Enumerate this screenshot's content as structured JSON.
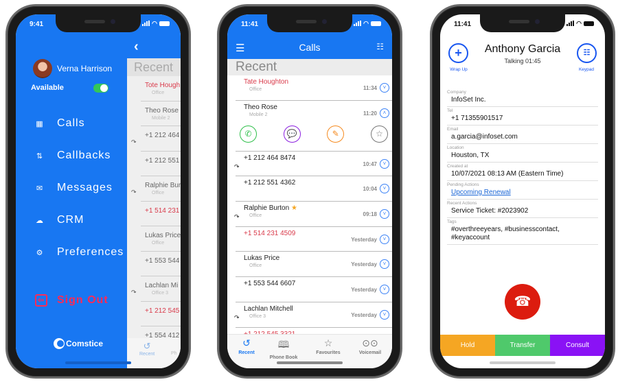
{
  "phone1": {
    "status_time": "9:41",
    "drawer": {
      "user_name": "Verna Harrison",
      "availability_label": "Available",
      "availability_on": true,
      "menu": [
        {
          "label": "Calls",
          "icon": "grid-icon"
        },
        {
          "label": "Callbacks",
          "icon": "arrows-updown-icon"
        },
        {
          "label": "Messages",
          "icon": "envelope-icon"
        },
        {
          "label": "CRM",
          "icon": "cloud-upload-icon"
        },
        {
          "label": "Preferences",
          "icon": "gear-icon"
        }
      ],
      "sign_out_label": "Sign Out",
      "logo_text": "Comstice"
    },
    "behind": {
      "section_title": "Recent",
      "rows": [
        {
          "name": "Tote Hough",
          "sub": "Office",
          "missed": true,
          "forwarded": false
        },
        {
          "name": "Theo Rose",
          "sub": "Mobile 2",
          "missed": false,
          "forwarded": false
        },
        {
          "name": "+1 212 464",
          "sub": "",
          "missed": false,
          "forwarded": true
        },
        {
          "name": "+1 212 551",
          "sub": "",
          "missed": false,
          "forwarded": false
        },
        {
          "name": "Ralphie Bur",
          "sub": "Office",
          "missed": false,
          "forwarded": true
        },
        {
          "name": "+1 514 231",
          "sub": "",
          "missed": true,
          "forwarded": false
        },
        {
          "name": "Lukas Price",
          "sub": "Office",
          "missed": false,
          "forwarded": false
        },
        {
          "name": "+1 553 544",
          "sub": "",
          "missed": false,
          "forwarded": false
        },
        {
          "name": "Lachlan Mi",
          "sub": "Office 3",
          "missed": false,
          "forwarded": true
        },
        {
          "name": "+1 212 545",
          "sub": "",
          "missed": true,
          "forwarded": false
        },
        {
          "name": "+1 554 412",
          "sub": "",
          "missed": false,
          "forwarded": false
        }
      ],
      "tab_recent": "Recent",
      "tab_partial": "Ph"
    }
  },
  "phone2": {
    "status_time": "11:41",
    "nav_title": "Calls",
    "section_title": "Recent",
    "rows": [
      {
        "name": "Tate Houghton",
        "sub": "Office",
        "time": "11:34",
        "missed": true,
        "forwarded": false,
        "favourite": false
      },
      {
        "name": "Theo Rose",
        "sub": "Mobile 2",
        "time": "11:20",
        "missed": false,
        "forwarded": false,
        "favourite": false,
        "expanded": true
      },
      {
        "name": "+1 212 464 8474",
        "sub": "",
        "time": "10:47",
        "missed": false,
        "forwarded": true,
        "favourite": false
      },
      {
        "name": "+1 212 551 4362",
        "sub": "",
        "time": "10:04",
        "missed": false,
        "forwarded": false,
        "favourite": false
      },
      {
        "name": "Ralphie Burton",
        "sub": "Office",
        "time": "09:18",
        "missed": false,
        "forwarded": true,
        "favourite": true
      },
      {
        "name": "+1 514 231 4509",
        "sub": "",
        "time": "Yesterday",
        "missed": true,
        "forwarded": false,
        "favourite": false
      },
      {
        "name": "Lukas Price",
        "sub": "Office",
        "time": "Yesterday",
        "missed": false,
        "forwarded": false,
        "favourite": false
      },
      {
        "name": "+1 553 544 6607",
        "sub": "",
        "time": "Yesterday",
        "missed": false,
        "forwarded": false,
        "favourite": false
      },
      {
        "name": "Lachlan Mitchell",
        "sub": "Office 3",
        "time": "Yesterday",
        "missed": false,
        "forwarded": true,
        "favourite": false
      },
      {
        "name": "+1 212 545 3321",
        "sub": "",
        "time": "Yesterday",
        "missed": true,
        "forwarded": false,
        "favourite": false
      }
    ],
    "row_actions": [
      {
        "name": "call",
        "color": "#2fbf4a"
      },
      {
        "name": "message",
        "color": "#8a1ee0"
      },
      {
        "name": "note",
        "color": "#f58a1f"
      },
      {
        "name": "favourite",
        "color": "#777777"
      }
    ],
    "tabs": [
      {
        "label": "Recent",
        "active": true
      },
      {
        "label": "Phone Book",
        "active": false
      },
      {
        "label": "Favourites",
        "active": false
      },
      {
        "label": "Voicemail",
        "active": false
      }
    ]
  },
  "phone3": {
    "status_time": "11:41",
    "contact_name": "Anthony Garcia",
    "call_status": "Talking 01:45",
    "wrap_up_label": "Wrap Up",
    "keypad_label": "Keypad",
    "fields": [
      {
        "label": "Company",
        "value": "InfoSet Inc."
      },
      {
        "label": "Tel",
        "value": "+1 71355901517"
      },
      {
        "label": "Email",
        "value": "a.garcia@infoset.com"
      },
      {
        "label": "Location",
        "value": "Houston, TX"
      },
      {
        "label": "Created at",
        "value": "10/07/2021 08:13 AM   (Eastern Time)"
      },
      {
        "label": "Pending Actions",
        "value": "Upcoming Renewal",
        "link": true
      },
      {
        "label": "Recent Actions",
        "value": "Service Ticket: #2023902"
      },
      {
        "label": "Tags",
        "value": "#overthreeyears, #businesscontact, #keyaccount"
      }
    ],
    "actions": [
      {
        "label": "Hold",
        "color": "#f5a623"
      },
      {
        "label": "Transfer",
        "color": "#4fc96b"
      },
      {
        "label": "Consult",
        "color": "#8a12f5"
      }
    ]
  },
  "colors": {
    "brand_blue": "#1877f2",
    "missed_red": "#d93a4a",
    "hangup_red": "#dc1c0f",
    "sign_out_pink": "#ff2a55"
  }
}
